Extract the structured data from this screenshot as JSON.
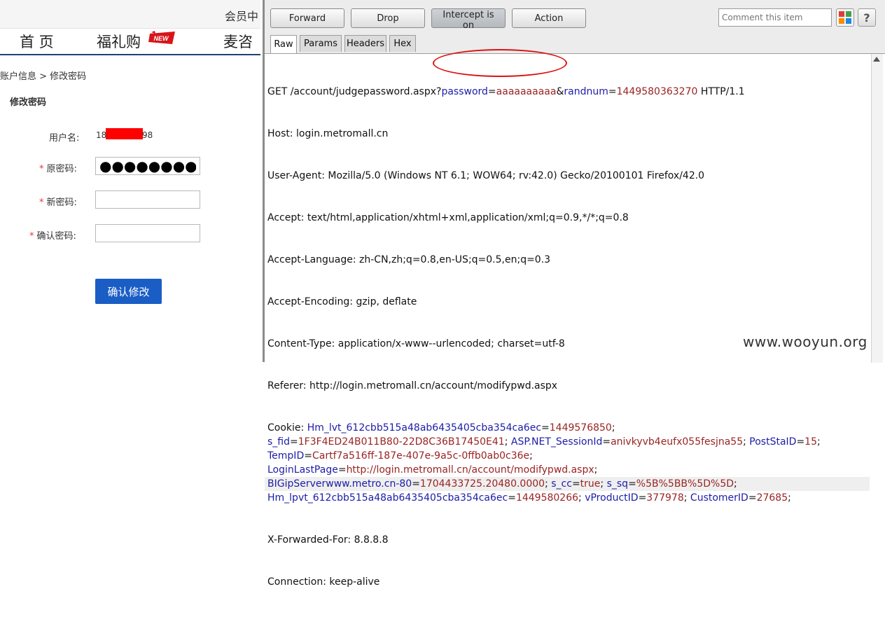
{
  "left_page": {
    "member_text": "会员中",
    "nav": {
      "home": "首 页",
      "gift": "福礼购",
      "new_badge": "NEW",
      "mai": "麦咨"
    },
    "breadcrumb": "账户信息 > 修改密码",
    "section_title": "修改密码",
    "form": {
      "required_mark": "*",
      "username_label": "用户名:",
      "username_start": "18",
      "username_end": "98",
      "old_password_label": "原密码:",
      "old_password_value": "●●●●●●●●●●",
      "new_password_label": "新密码:",
      "confirm_password_label": "确认密码:",
      "submit_label": "确认修改"
    }
  },
  "burp": {
    "toolbar": {
      "forward": "Forward",
      "drop": "Drop",
      "intercept": "Intercept is on",
      "action": "Action",
      "comment_placeholder": "Comment this item",
      "help": "?"
    },
    "tabs": [
      "Raw",
      "Params",
      "Headers",
      "Hex"
    ],
    "request": {
      "request_line": {
        "method_path": "GET /account/judgepassword.aspx?",
        "p1_key": "password",
        "p1_val": "aaaaaaaaaa",
        "amp": "&",
        "p2_key": "randnum",
        "p2_val": "1449580363270",
        "proto": " HTTP/1.1"
      },
      "host": "Host: login.metromall.cn",
      "user_agent": "User-Agent: Mozilla/5.0 (Windows NT 6.1; WOW64; rv:42.0) Gecko/20100101 Firefox/42.0",
      "accept": "Accept: text/html,application/xhtml+xml,application/xml;q=0.9,*/*;q=0.8",
      "accept_language": "Accept-Language: zh-CN,zh;q=0.8,en-US;q=0.5,en;q=0.3",
      "accept_encoding": "Accept-Encoding: gzip, deflate",
      "content_type": "Content-Type: application/x-www--urlencoded; charset=utf-8",
      "referer": "Referer: http://login.metromall.cn/account/modifypwd.aspx",
      "cookie_label": "Cookie: ",
      "cookies": [
        [
          {
            "k": "Hm_lvt_612cbb515a48ab6435405cba354ca6ec",
            "v": "1449576850"
          }
        ],
        [
          {
            "k": "s_fid",
            "v": "1F3F4ED24B011B80-22D8C36B17450E41"
          },
          {
            "k": "ASP.NET_SessionId",
            "v": "anivkyvb4eufx055fesjna55"
          },
          {
            "k": "PostStaID",
            "v": "15"
          }
        ],
        [
          {
            "k": "TempID",
            "v": "Cartf7a516ff-187e-407e-9a5c-0ffb0ab0c36e"
          }
        ],
        [
          {
            "k": "LoginLastPage",
            "v": "http://login.metromall.cn/account/modifypwd.aspx"
          }
        ],
        [
          {
            "k": "BIGipServerwww.metro.cn-80",
            "v": "1704433725.20480.0000"
          },
          {
            "k": "s_cc",
            "v": "true"
          },
          {
            "k": "s_sq",
            "v": "%5B%5BB%5D%5D"
          }
        ],
        [
          {
            "k": "Hm_lpvt_612cbb515a48ab6435405cba354ca6ec",
            "v": "1449580266"
          },
          {
            "k": "vProductID",
            "v": "377978"
          },
          {
            "k": "CustomerID",
            "v": "27685"
          }
        ]
      ],
      "x_forwarded_for": "X-Forwarded-For: 8.8.8.8",
      "connection": "Connection: keep-alive"
    },
    "colors": {
      "key": "#1c1ca8",
      "value": "#9a2323",
      "highlight_ellipse": "#dd1111"
    }
  },
  "watermark": "www.wooyun.org"
}
